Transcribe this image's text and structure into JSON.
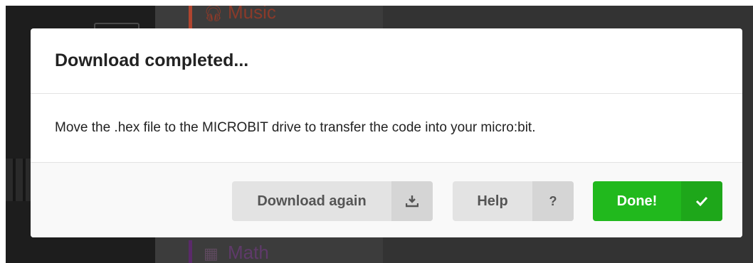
{
  "background": {
    "categories": [
      {
        "label": "Music",
        "icon": "headphones-icon",
        "color": "#b0452f"
      },
      {
        "label": "Math",
        "icon": "calculator-icon",
        "color": "#5a2a6a"
      }
    ]
  },
  "dialog": {
    "title": "Download completed...",
    "message": "Move the .hex file to the MICROBIT drive to transfer the code into your micro:bit.",
    "buttons": {
      "download_again": {
        "label": "Download again",
        "icon": "download-icon"
      },
      "help": {
        "label": "Help",
        "icon": "?"
      },
      "done": {
        "label": "Done!",
        "icon": "checkmark-icon",
        "color": "#21b91d"
      }
    }
  }
}
